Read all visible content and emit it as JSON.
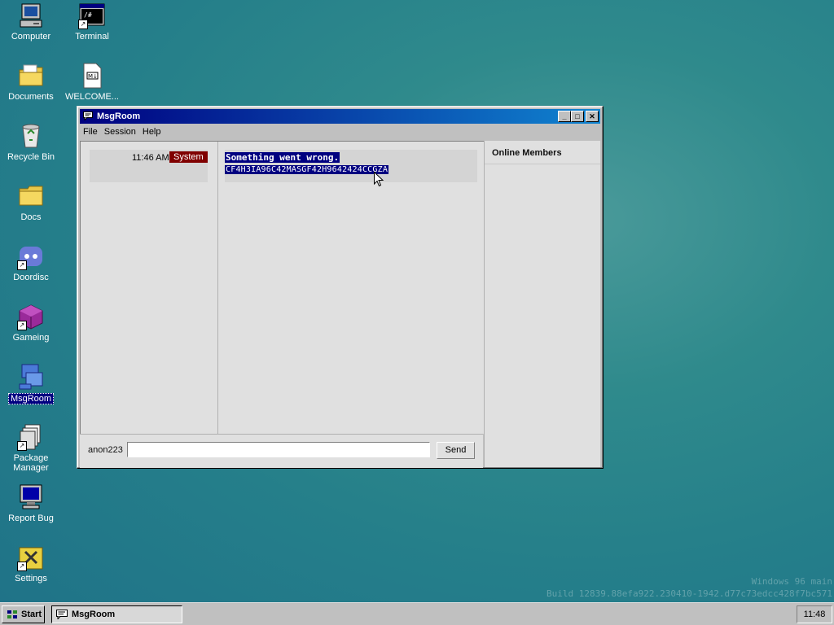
{
  "desktop": {
    "icons": [
      {
        "label": "Computer"
      },
      {
        "label": "Terminal"
      },
      {
        "label": "Documents"
      },
      {
        "label": "WELCOME..."
      },
      {
        "label": "Recycle Bin"
      },
      {
        "label": "Docs"
      },
      {
        "label": "Doordisc"
      },
      {
        "label": "Gameing"
      },
      {
        "label": "MsgRoom"
      },
      {
        "label": "Package Manager"
      },
      {
        "label": "Report Bug"
      },
      {
        "label": "Settings"
      }
    ],
    "watermark_line1": "Windows 96 main",
    "watermark_line2": "Build 12839.88efa922.230410-1942.d77c73edcc428f7bc571"
  },
  "window": {
    "title": "MsgRoom",
    "controls": {
      "minimize": "_",
      "maximize": "□",
      "close": "✕"
    },
    "menu": [
      "File",
      "Session",
      "Help"
    ],
    "message": {
      "time": "11:46 AM",
      "sender": "System",
      "line1": "Something went wrong.",
      "line2": "CF4H3IA96C42MASGF42H9642424CCGZA"
    },
    "members_title": "Online Members",
    "username": "anon223",
    "input_value": "",
    "send_label": "Send"
  },
  "taskbar": {
    "start_label": "Start",
    "task_label": "MsgRoom",
    "clock": "11:48"
  }
}
